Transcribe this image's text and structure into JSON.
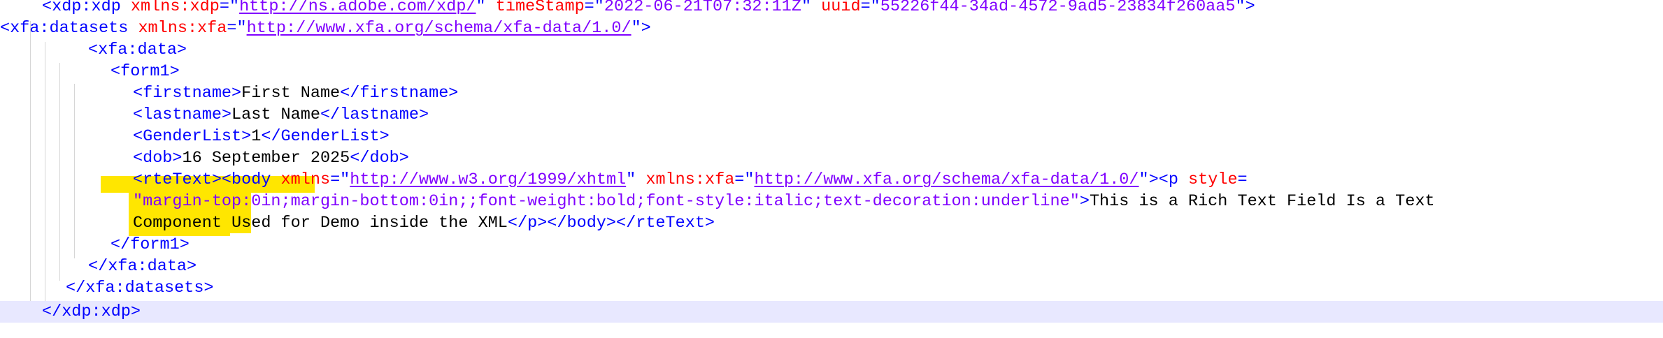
{
  "editor": {
    "language": "XML",
    "current_line_color": "#e8e8ff",
    "highlight_color": "#ffe600",
    "colors": {
      "tag": "#0000ff",
      "attribute": "#ff0000",
      "value": "#8000ff",
      "text": "#000000"
    }
  },
  "lines": [
    {
      "id": "xdp-open",
      "segs": [
        {
          "k": "t",
          "s": "<xdp:xdp "
        },
        {
          "k": "a",
          "s": "xmlns:xdp"
        },
        {
          "k": "t",
          "s": "=\""
        },
        {
          "k": "u",
          "s": "http://ns.adobe.com/xdp/"
        },
        {
          "k": "t",
          "s": "\" "
        },
        {
          "k": "a",
          "s": "timeStamp"
        },
        {
          "k": "t",
          "s": "=\""
        },
        {
          "k": "v",
          "s": "2022-06-21T07:32:11Z"
        },
        {
          "k": "t",
          "s": "\" "
        },
        {
          "k": "a",
          "s": "uuid"
        },
        {
          "k": "t",
          "s": "=\""
        },
        {
          "k": "v",
          "s": "55226f44-34ad-4572-9ad5-23834f260aa5"
        },
        {
          "k": "t",
          "s": "\">"
        }
      ]
    },
    {
      "id": "datasets-open",
      "segs": [
        {
          "k": "t",
          "s": "<xfa:datasets "
        },
        {
          "k": "a",
          "s": "xmlns:xfa"
        },
        {
          "k": "t",
          "s": "=\""
        },
        {
          "k": "u",
          "s": "http://www.xfa.org/schema/xfa-data/1.0/"
        },
        {
          "k": "t",
          "s": "\">"
        }
      ]
    },
    {
      "id": "data-open",
      "segs": [
        {
          "k": "t",
          "s": "<xfa:data>"
        }
      ]
    },
    {
      "id": "form1-open",
      "segs": [
        {
          "k": "t",
          "s": "<form1>"
        }
      ]
    },
    {
      "id": "firstname",
      "segs": [
        {
          "k": "t",
          "s": "<firstname>"
        },
        {
          "k": "x",
          "s": "First Name"
        },
        {
          "k": "t",
          "s": "</firstname>"
        }
      ]
    },
    {
      "id": "lastname",
      "segs": [
        {
          "k": "t",
          "s": "<lastname>"
        },
        {
          "k": "x",
          "s": "Last Name"
        },
        {
          "k": "t",
          "s": "</lastname>"
        }
      ]
    },
    {
      "id": "genderlist",
      "segs": [
        {
          "k": "t",
          "s": "<GenderList>"
        },
        {
          "k": "x",
          "s": "1"
        },
        {
          "k": "t",
          "s": "</GenderList>"
        }
      ]
    },
    {
      "id": "dob",
      "segs": [
        {
          "k": "t",
          "s": "<dob>"
        },
        {
          "k": "x",
          "s": "16 September 2025"
        },
        {
          "k": "t",
          "s": "</dob>"
        }
      ]
    },
    {
      "id": "rtetext-1",
      "segs": [
        {
          "k": "t",
          "s": "<rteText><body "
        },
        {
          "k": "a",
          "s": "xmlns"
        },
        {
          "k": "t",
          "s": "=\""
        },
        {
          "k": "u",
          "s": "http://www.w3.org/1999/xhtml"
        },
        {
          "k": "t",
          "s": "\" "
        },
        {
          "k": "a",
          "s": "xmlns:xfa"
        },
        {
          "k": "t",
          "s": "=\""
        },
        {
          "k": "u",
          "s": "http://www.xfa.org/schema/xfa-data/1.0/"
        },
        {
          "k": "t",
          "s": "\"><p "
        },
        {
          "k": "a",
          "s": "style"
        },
        {
          "k": "t",
          "s": "="
        }
      ]
    },
    {
      "id": "rtetext-2",
      "segs": [
        {
          "k": "v",
          "s": "\"margin-top:0in;margin-bottom:0in;;font-weight:bold;font-style:italic;text-decoration:underline\""
        },
        {
          "k": "t",
          "s": ">"
        },
        {
          "k": "x",
          "s": "This is a Rich Text Field Is a Text"
        }
      ]
    },
    {
      "id": "rtetext-3",
      "segs": [
        {
          "k": "x",
          "s": "Component Used for Demo inside the XML"
        },
        {
          "k": "t",
          "s": "</p></body></rteText>"
        }
      ]
    },
    {
      "id": "form1-close",
      "segs": [
        {
          "k": "t",
          "s": "</form1>"
        }
      ]
    },
    {
      "id": "data-close",
      "segs": [
        {
          "k": "t",
          "s": "</xfa:data>"
        }
      ]
    },
    {
      "id": "datasets-close",
      "segs": [
        {
          "k": "t",
          "s": "</xfa:datasets>"
        }
      ]
    },
    {
      "id": "xdp-close",
      "segs": [
        {
          "k": "t",
          "s": "</xdp:xdp>"
        }
      ]
    }
  ]
}
